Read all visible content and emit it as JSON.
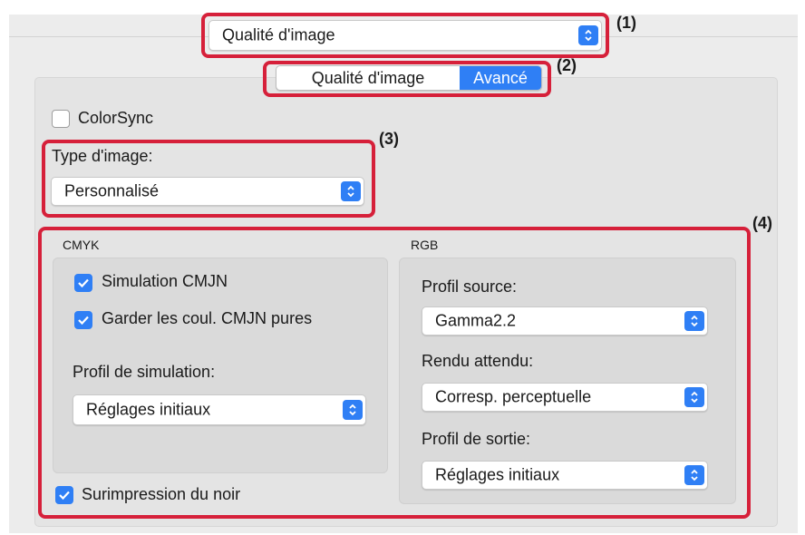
{
  "main_select": {
    "value": "Qualité d'image"
  },
  "tabs": [
    {
      "label": "Qualité d'image",
      "selected": false
    },
    {
      "label": "Avancé",
      "selected": true
    }
  ],
  "colorsync": {
    "label": "ColorSync",
    "checked": false
  },
  "image_type": {
    "label": "Type d'image:",
    "value": "Personnalisé"
  },
  "cmyk": {
    "title": "CMYK",
    "simulation": {
      "label": "Simulation CMJN",
      "checked": true
    },
    "keep_pure": {
      "label": "Garder les coul. CMJN pures",
      "checked": true
    },
    "profile_label": "Profil de simulation:",
    "profile_value": "Réglages initiaux"
  },
  "rgb": {
    "title": "RGB",
    "source_label": "Profil source:",
    "source_value": "Gamma2.2",
    "intent_label": "Rendu attendu:",
    "intent_value": "Corresp. perceptuelle",
    "output_label": "Profil de sortie:",
    "output_value": "Réglages initiaux"
  },
  "overprint": {
    "label": "Surimpression du noir",
    "checked": true
  },
  "callouts": [
    "(1)",
    "(2)",
    "(3)",
    "(4)"
  ],
  "colors": {
    "accent": "#2f7ff5",
    "highlight": "#d6203a"
  }
}
